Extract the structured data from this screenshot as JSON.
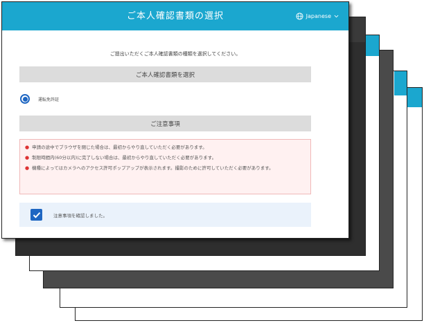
{
  "header": {
    "title": "ご本人確認書類の選択",
    "language": "Japanese"
  },
  "main": {
    "instruction": "ご提出いただくご本人確認書類の種類を選択してください。",
    "document_section_title": "ご本人確認書類を選択",
    "document_options": [
      {
        "label": "運転免許証",
        "selected": true
      }
    ],
    "notice_section_title": "ご注意事項",
    "notices": [
      "申請の途中でブラウザを閉じた場合は、最初からやり直していただく必要があります。",
      "制限時間内(60分以内)に完了しない場合は、最初からやり直していただく必要があります。",
      "機種によってはカメラへのアクセス許可ポップアップが表示されます。撮影のために許可していただく必要があります。"
    ],
    "confirm": {
      "label": "注意事項を確認しました。",
      "checked": true
    }
  },
  "colors": {
    "header": "#1ba7cf",
    "selection": "#1e66c2",
    "notice_bg": "#fff1f1",
    "notice_border": "#f0b8b8",
    "confirm_bg": "#eaf2fb"
  }
}
